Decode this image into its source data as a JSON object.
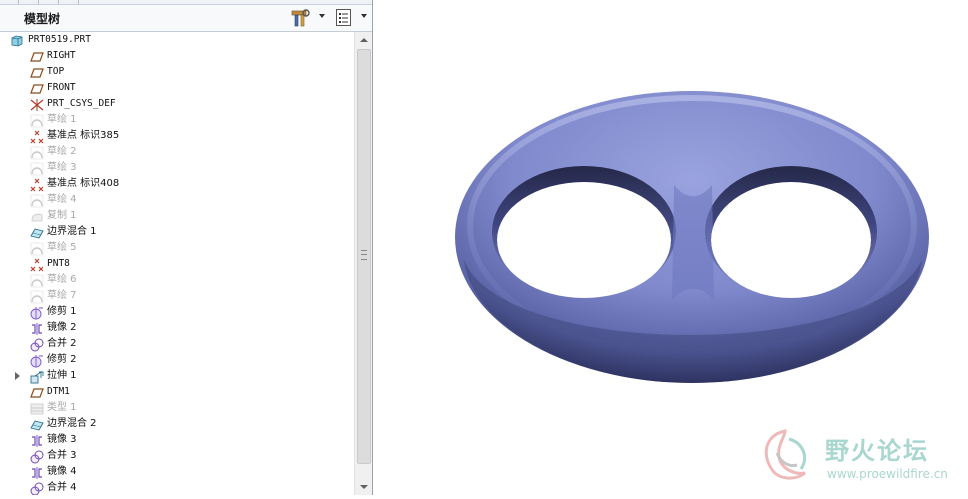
{
  "panel": {
    "title": "模型树",
    "tools": [
      {
        "icon": "settings-tools-icon"
      },
      {
        "icon": "show-list-icon"
      }
    ]
  },
  "tree": [
    {
      "label": "PRT0519.PRT",
      "icon": "part-icon",
      "state": "normal"
    },
    {
      "label": "RIGHT",
      "icon": "datum-plane-icon",
      "state": "normal"
    },
    {
      "label": "TOP",
      "icon": "datum-plane-icon",
      "state": "normal"
    },
    {
      "label": "FRONT",
      "icon": "datum-plane-icon",
      "state": "normal"
    },
    {
      "label": "PRT_CSYS_DEF",
      "icon": "coordinate-system-icon",
      "state": "normal"
    },
    {
      "label": "草绘 1",
      "icon": "sketch-icon",
      "state": "dim"
    },
    {
      "label": "基准点 标识385",
      "icon": "datum-point-icon",
      "state": "normal"
    },
    {
      "label": "草绘 2",
      "icon": "sketch-icon",
      "state": "dim"
    },
    {
      "label": "草绘 3",
      "icon": "sketch-icon",
      "state": "dim"
    },
    {
      "label": "基准点 标识408",
      "icon": "datum-point-icon",
      "state": "normal"
    },
    {
      "label": "草绘 4",
      "icon": "sketch-icon",
      "state": "dim"
    },
    {
      "label": "复制 1",
      "icon": "copy-icon",
      "state": "dim"
    },
    {
      "label": "边界混合 1",
      "icon": "boundary-blend-icon",
      "state": "normal"
    },
    {
      "label": "草绘 5",
      "icon": "sketch-icon",
      "state": "dim"
    },
    {
      "label": "PNT8",
      "icon": "datum-point-icon",
      "state": "normal"
    },
    {
      "label": "草绘 6",
      "icon": "sketch-icon",
      "state": "dim"
    },
    {
      "label": "草绘 7",
      "icon": "sketch-icon",
      "state": "dim"
    },
    {
      "label": "修剪 1",
      "icon": "trim-icon",
      "state": "normal"
    },
    {
      "label": "镜像 2",
      "icon": "mirror-icon",
      "state": "normal"
    },
    {
      "label": "合并 2",
      "icon": "merge-icon",
      "state": "normal"
    },
    {
      "label": "修剪 2",
      "icon": "trim-icon",
      "state": "normal"
    },
    {
      "label": "拉伸 1",
      "icon": "extrude-icon",
      "state": "normal",
      "expandable": true
    },
    {
      "label": "DTM1",
      "icon": "datum-plane-icon",
      "state": "normal"
    },
    {
      "label": "类型 1",
      "icon": "pattern-icon",
      "state": "dim"
    },
    {
      "label": "边界混合 2",
      "icon": "boundary-blend-icon",
      "state": "normal"
    },
    {
      "label": "镜像 3",
      "icon": "mirror-icon",
      "state": "normal"
    },
    {
      "label": "合并 3",
      "icon": "merge-icon",
      "state": "normal"
    },
    {
      "label": "镜像 4",
      "icon": "mirror-icon",
      "state": "normal"
    },
    {
      "label": "合并 4",
      "icon": "merge-icon",
      "state": "normal"
    }
  ],
  "viewport": {
    "model": "double-loop-torus-surface",
    "model_color": "#7f89cc"
  },
  "watermark": {
    "title": "野火论坛",
    "url": "www.proewildfire.cn",
    "color": "#a9d6cf"
  }
}
